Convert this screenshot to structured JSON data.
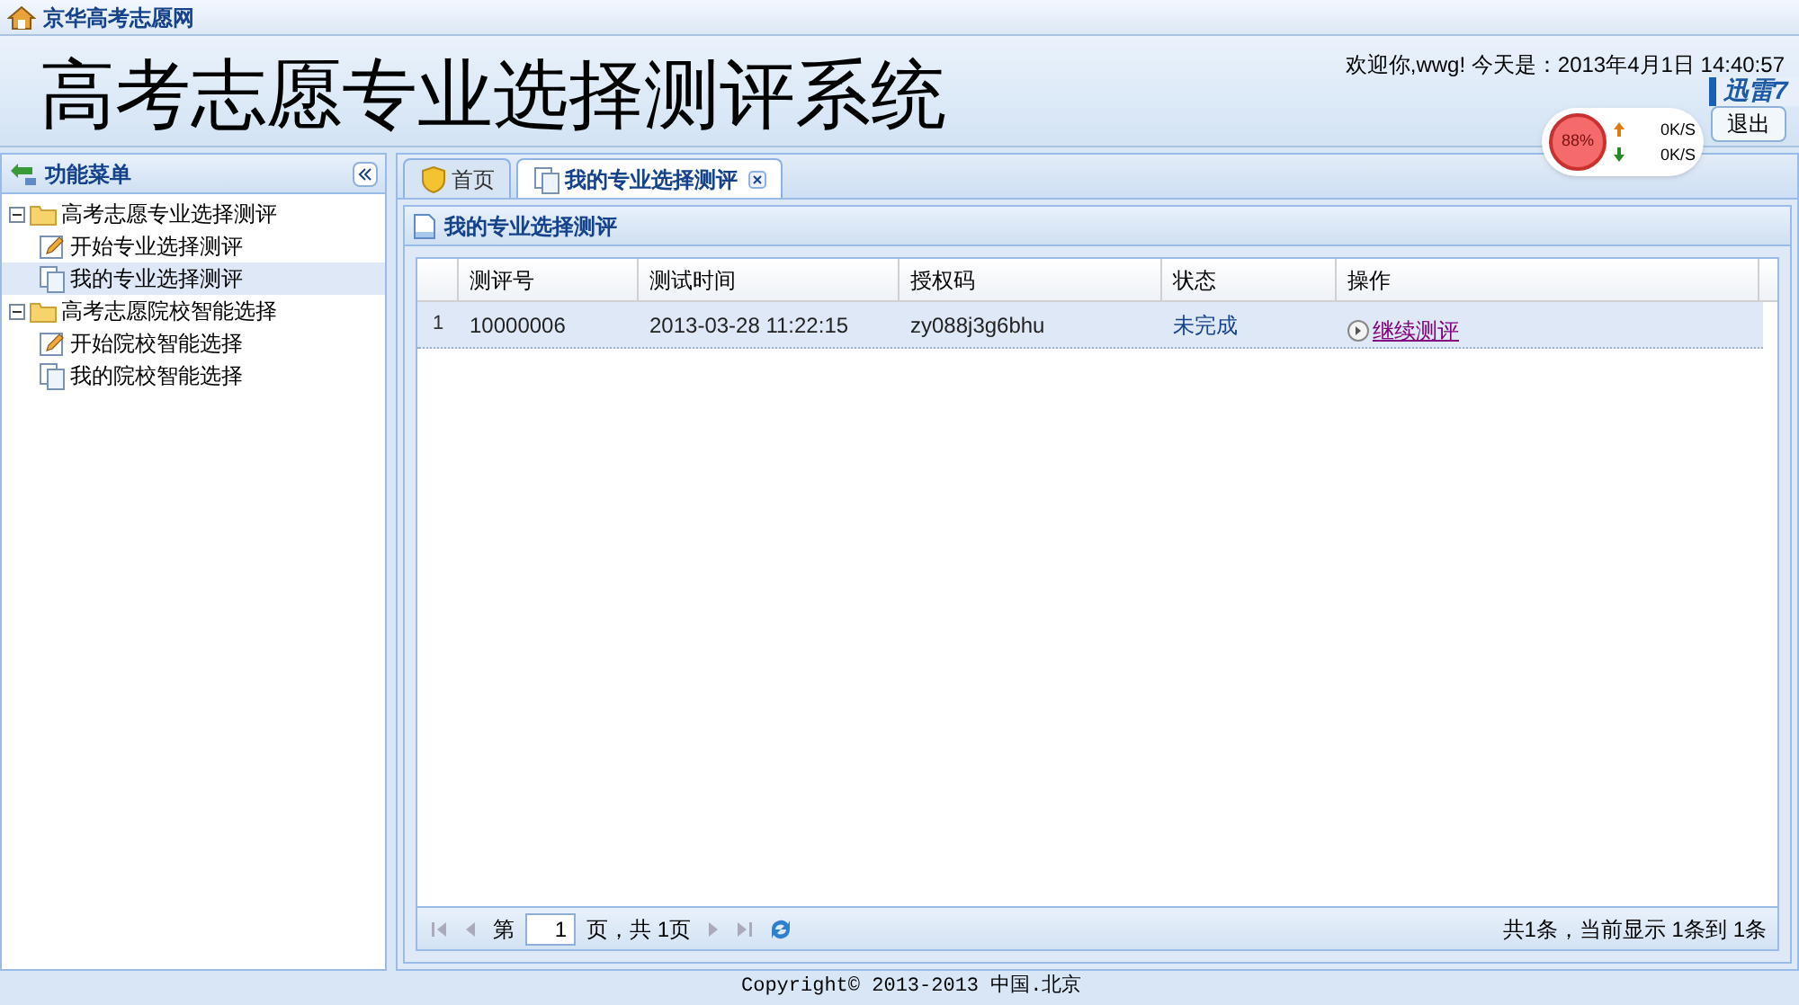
{
  "site_title": "京华高考志愿网",
  "header": {
    "title": "高考志愿专业选择测评系统",
    "welcome": "欢迎你,wwg!  今天是：2013年4月1日 14:40:57",
    "logout": "退出"
  },
  "floating_widget": {
    "percent": "88%",
    "upload": "0K/S",
    "download": "0K/S",
    "brand": "迅雷7"
  },
  "sidebar": {
    "title": "功能菜单",
    "items": [
      {
        "label": "高考志愿专业选择测评",
        "kind": "folder",
        "expanded": true,
        "selected": false,
        "children": [
          {
            "label": "开始专业选择测评",
            "kind": "edit",
            "selected": false
          },
          {
            "label": "我的专业选择测评",
            "kind": "page",
            "selected": true
          }
        ]
      },
      {
        "label": "高考志愿院校智能选择",
        "kind": "folder",
        "expanded": true,
        "selected": false,
        "children": [
          {
            "label": "开始院校智能选择",
            "kind": "edit",
            "selected": false
          },
          {
            "label": "我的院校智能选择",
            "kind": "page",
            "selected": false
          }
        ]
      }
    ]
  },
  "tabs": [
    {
      "label": "首页",
      "kind": "home",
      "selected": false,
      "closable": false
    },
    {
      "label": "我的专业选择测评",
      "kind": "page",
      "selected": true,
      "closable": true
    }
  ],
  "panel_title": "我的专业选择测评",
  "table": {
    "columns": [
      "测评号",
      "测试时间",
      "授权码",
      "状态",
      "操作"
    ],
    "rows": [
      {
        "index": "1",
        "cells": [
          "10000006",
          "2013-03-28 11:22:15",
          "zy088j3g6bhu",
          "未完成"
        ],
        "action": "继续测评",
        "selected": true
      }
    ]
  },
  "pager": {
    "page_prefix": "第",
    "page": "1",
    "page_suffix": "页，共 1页",
    "summary": "共1条，当前显示 1条到 1条"
  },
  "footer": "Copyright© 2013-2013 中国.北京"
}
